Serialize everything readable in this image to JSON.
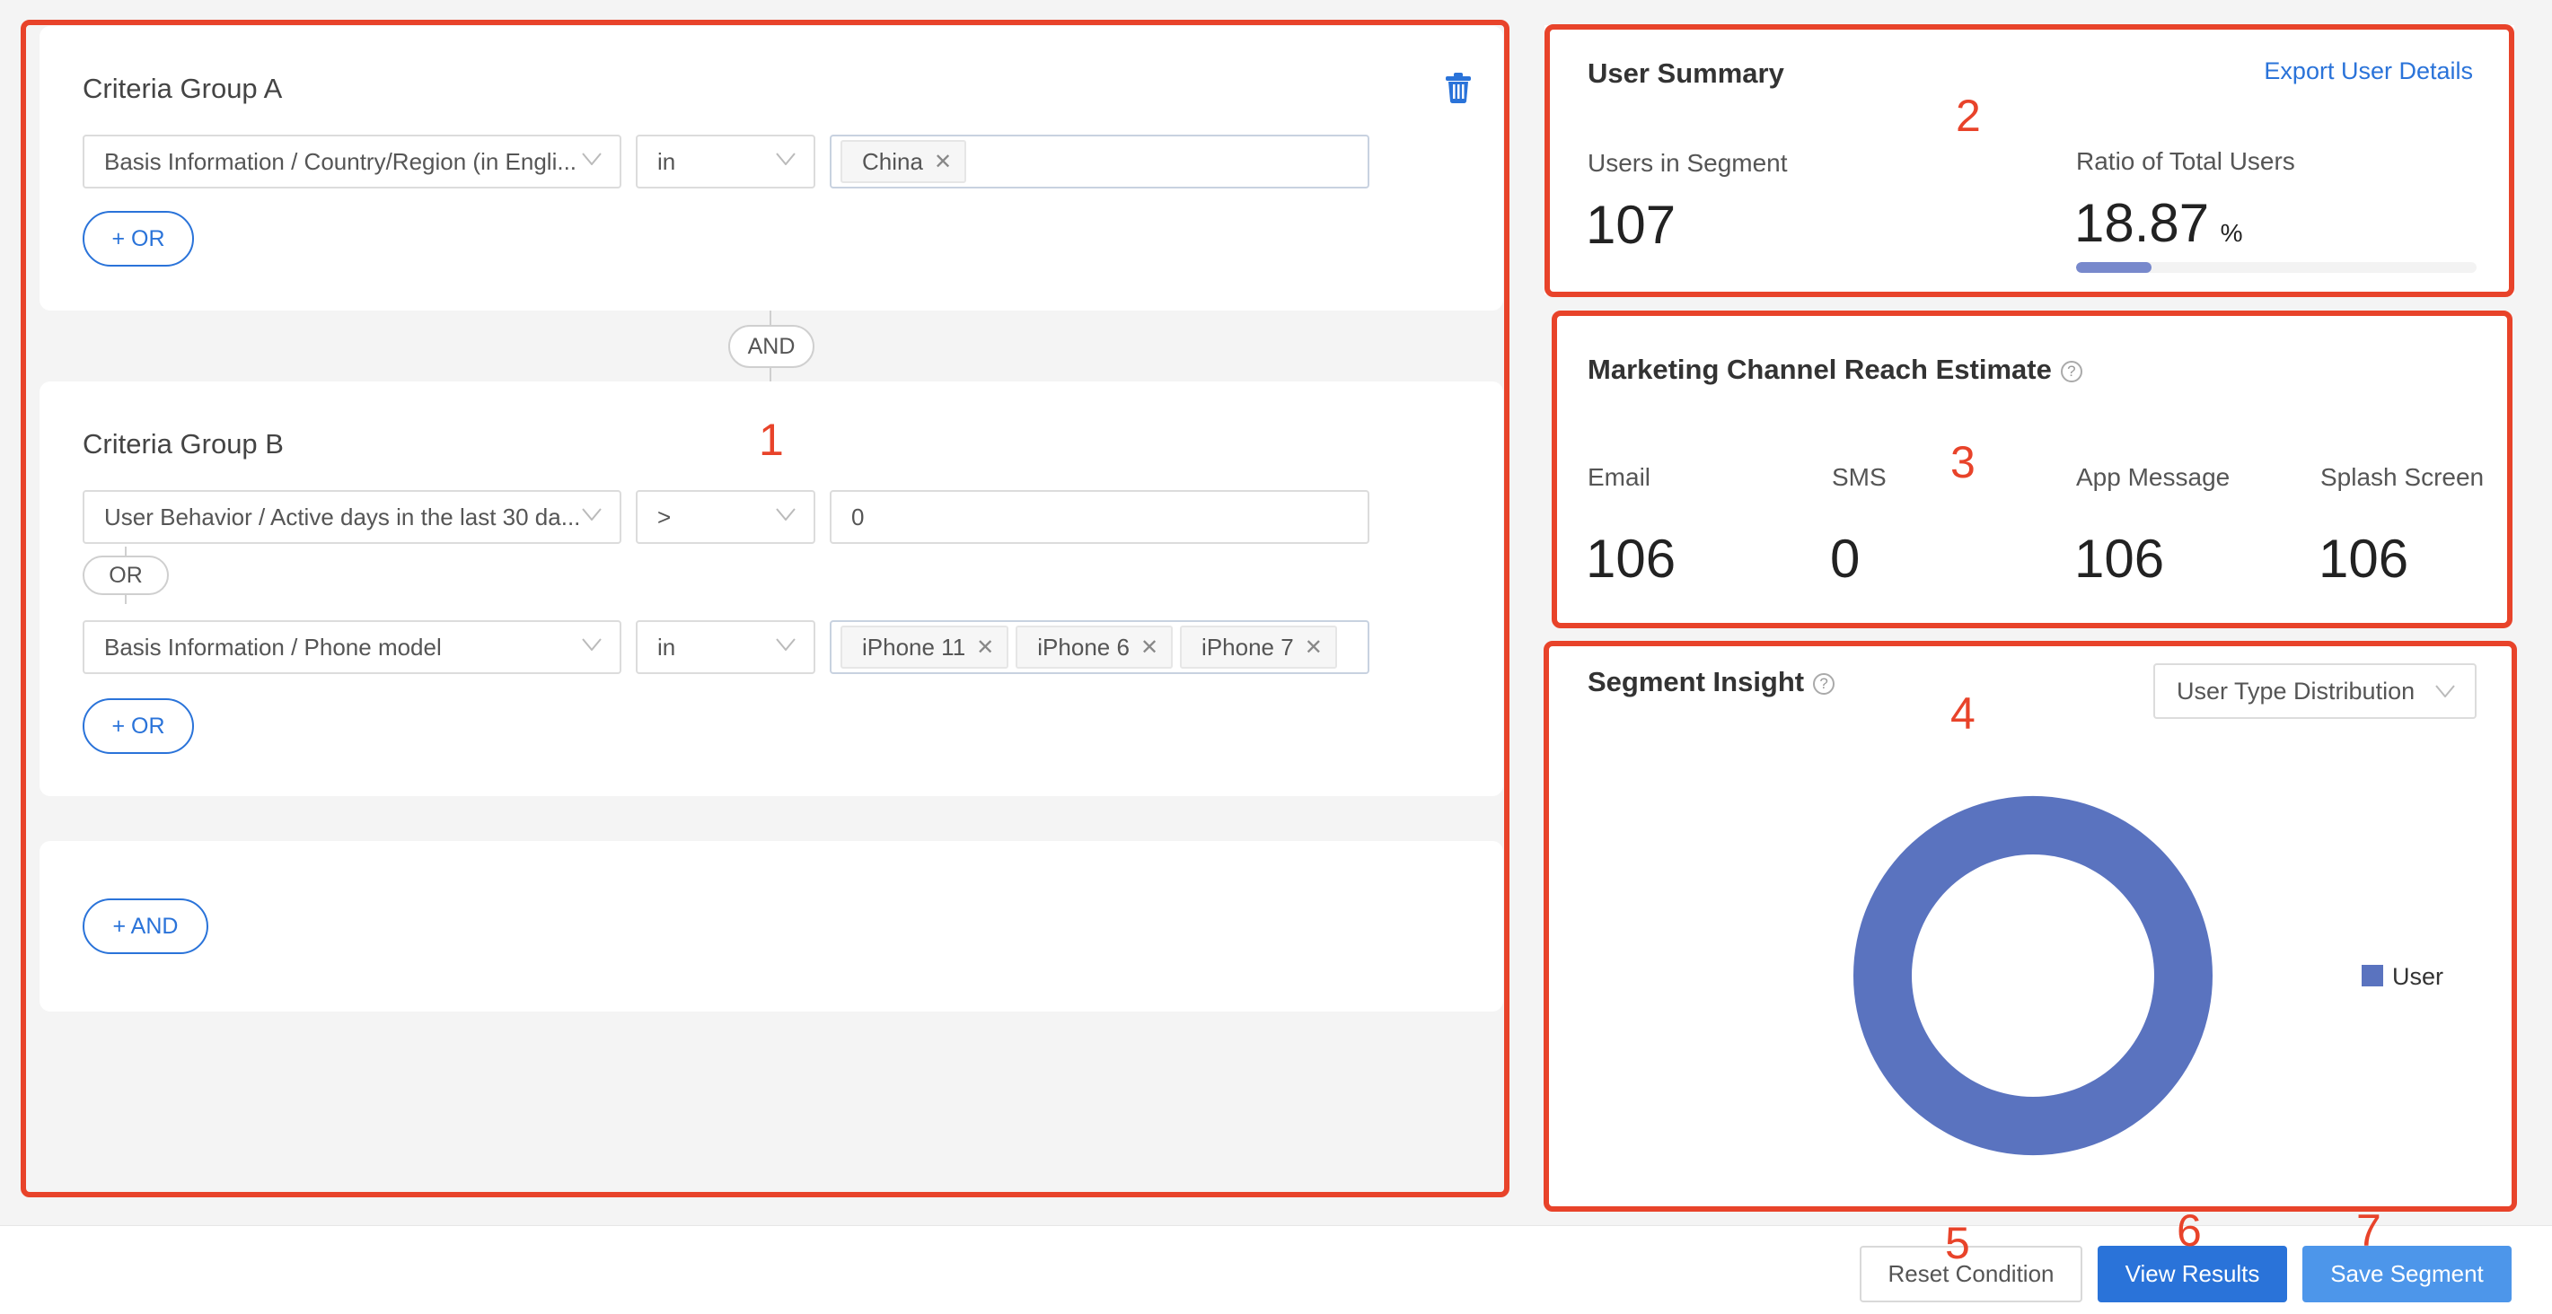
{
  "criteria": {
    "group_a": {
      "title": "Criteria Group A",
      "conditions": [
        {
          "attribute": "Basis Information / Country/Region (in Engli...",
          "operator": "in",
          "values": [
            "China"
          ]
        }
      ],
      "add_or_label": "+ OR"
    },
    "and_connector": "AND",
    "group_b": {
      "title": "Criteria Group B",
      "conditions": [
        {
          "attribute": "User Behavior / Active days in the last 30 da...",
          "operator": ">",
          "value": "0"
        },
        {
          "attribute": "Basis Information / Phone model",
          "operator": "in",
          "values": [
            "iPhone 11",
            "iPhone 6",
            "iPhone 7"
          ]
        }
      ],
      "or_connector": "OR",
      "add_or_label": "+ OR"
    },
    "add_and_label": "+ AND"
  },
  "user_summary": {
    "title": "User Summary",
    "export_link": "Export User Details",
    "users_in_segment_label": "Users in Segment",
    "users_in_segment_value": "107",
    "ratio_label": "Ratio of Total Users",
    "ratio_value": "18.87",
    "ratio_unit": "%",
    "ratio_fraction": 0.1887
  },
  "reach_estimate": {
    "title": "Marketing Channel Reach Estimate",
    "help_icon": "?",
    "channels": [
      {
        "label": "Email",
        "value": "106"
      },
      {
        "label": "SMS",
        "value": "0"
      },
      {
        "label": "App Message",
        "value": "106"
      },
      {
        "label": "Splash Screen",
        "value": "106"
      }
    ]
  },
  "segment_insight": {
    "title": "Segment Insight",
    "help_icon": "?",
    "dropdown_selected": "User Type Distribution"
  },
  "chart_data": {
    "type": "pie",
    "variant": "donut",
    "title": "",
    "categories": [
      "User"
    ],
    "values": [
      100
    ],
    "colors": [
      "#5a73bf"
    ],
    "legend": [
      "User"
    ],
    "legend_position": "right"
  },
  "footer": {
    "reset_label": "Reset Condition",
    "view_label": "View Results",
    "save_label": "Save Segment"
  },
  "annotations": [
    "1",
    "2",
    "3",
    "4",
    "5",
    "6",
    "7"
  ],
  "colors": {
    "accent": "#2a73d9",
    "accent_light": "#4d96ea",
    "annotation": "#e8432a",
    "chart": "#5a73bf",
    "progress": "#7889cc"
  }
}
